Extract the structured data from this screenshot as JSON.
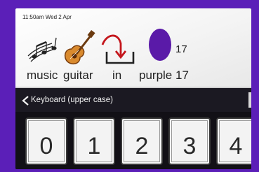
{
  "status": {
    "time_date": "11:50am  Wed 2 Apr"
  },
  "message": {
    "symbols": [
      {
        "label": "music",
        "icon": "music-notes-icon"
      },
      {
        "label": "guitar",
        "icon": "guitar-icon"
      },
      {
        "label": "in",
        "icon": "in-arrow-icon"
      },
      {
        "label": "purple",
        "icon": "purple-circle-icon"
      },
      {
        "label": "17",
        "top_label": "17"
      }
    ]
  },
  "nav": {
    "title": "Keyboard (upper case)",
    "back_icon": "chevron-left-icon"
  },
  "keyboard": {
    "keys": [
      "0",
      "1",
      "2",
      "3",
      "4"
    ]
  },
  "colors": {
    "bezel": "#5b1fb8",
    "purple": "#5a1aa8",
    "nav_bg": "#1b1922"
  }
}
